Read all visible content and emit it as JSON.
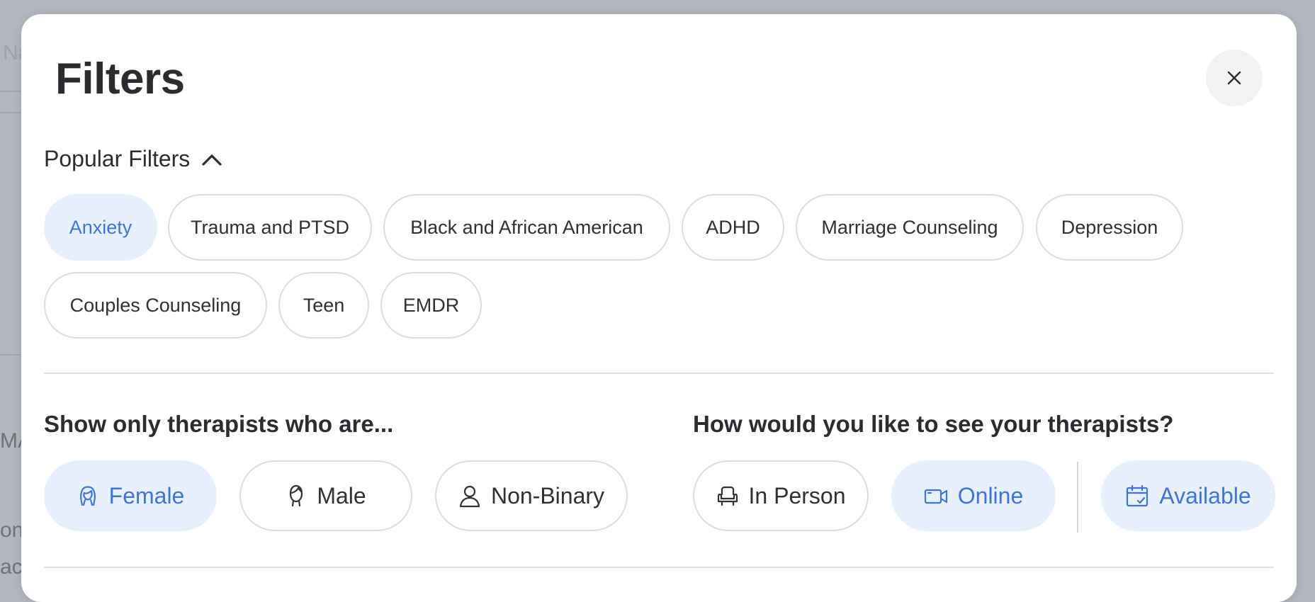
{
  "background": {
    "fragments": [
      "Na",
      "MA",
      "ons",
      "ace"
    ]
  },
  "modal": {
    "title": "Filters",
    "close_label": "×"
  },
  "popular": {
    "heading": "Popular Filters",
    "chips": [
      {
        "label": "Anxiety",
        "selected": true
      },
      {
        "label": "Trauma and PTSD",
        "selected": false
      },
      {
        "label": "Black and African American",
        "selected": false
      },
      {
        "label": "ADHD",
        "selected": false
      },
      {
        "label": "Marriage Counseling",
        "selected": false
      },
      {
        "label": "Depression",
        "selected": false
      },
      {
        "label": "Couples Counseling",
        "selected": false
      },
      {
        "label": "Teen",
        "selected": false
      },
      {
        "label": "EMDR",
        "selected": false
      }
    ]
  },
  "gender": {
    "heading": "Show only therapists who are...",
    "options": [
      {
        "label": "Female",
        "icon": "female-icon",
        "selected": true
      },
      {
        "label": "Male",
        "icon": "male-icon",
        "selected": false
      },
      {
        "label": "Non-Binary",
        "icon": "person-icon",
        "selected": false
      }
    ]
  },
  "session": {
    "heading": "How would you like to see your therapists?",
    "options": [
      {
        "label": "In Person",
        "icon": "armchair-icon",
        "selected": false
      },
      {
        "label": "Online",
        "icon": "video-camera-icon",
        "selected": true
      },
      {
        "label": "Available",
        "icon": "calendar-check-icon",
        "selected": true
      }
    ]
  },
  "colors": {
    "selected_bg": "#e9f0fd",
    "selected_text": "#3f74d6",
    "text": "#2a2c30",
    "border": "#dcdde0"
  }
}
